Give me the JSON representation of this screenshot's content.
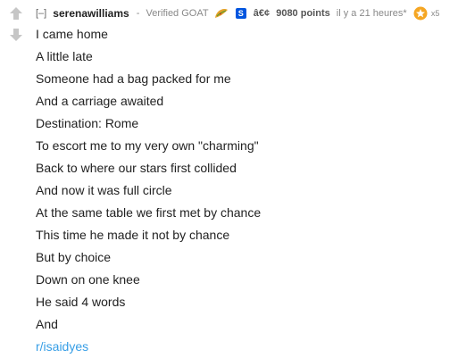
{
  "comment": {
    "expand_toggle": "[–]",
    "author": "serenawilliams",
    "separator": "-",
    "flair_text": "Verified GOAT",
    "submitter_badge": "S",
    "garbled_bullet": "â€¢",
    "score": "9080 points",
    "timestamp": "il y a 21 heures*",
    "gilded_count": "x5",
    "icons": {
      "upvote": "upvote-arrow-icon",
      "downvote": "downvote-arrow-icon",
      "flair": "taco-flair-icon",
      "gold": "gold-star-icon"
    },
    "colors": {
      "link": "#369ee6",
      "submitter_badge": "#0055df",
      "gold": "#f5a623",
      "arrow": "#c6c6c6"
    },
    "lines": [
      "I came home",
      "A little late",
      "Someone had a bag packed for me",
      "And a carriage awaited",
      "Destination: Rome",
      "To escort me to my very own \"charming\"",
      "Back to where our stars first collided",
      "And now it was full circle",
      "At the same table we first met by chance",
      "This time he made it not by chance",
      "But by choice",
      "Down on one knee",
      "He said 4 words",
      "And"
    ],
    "subreddit_link": "r/isaidyes"
  }
}
